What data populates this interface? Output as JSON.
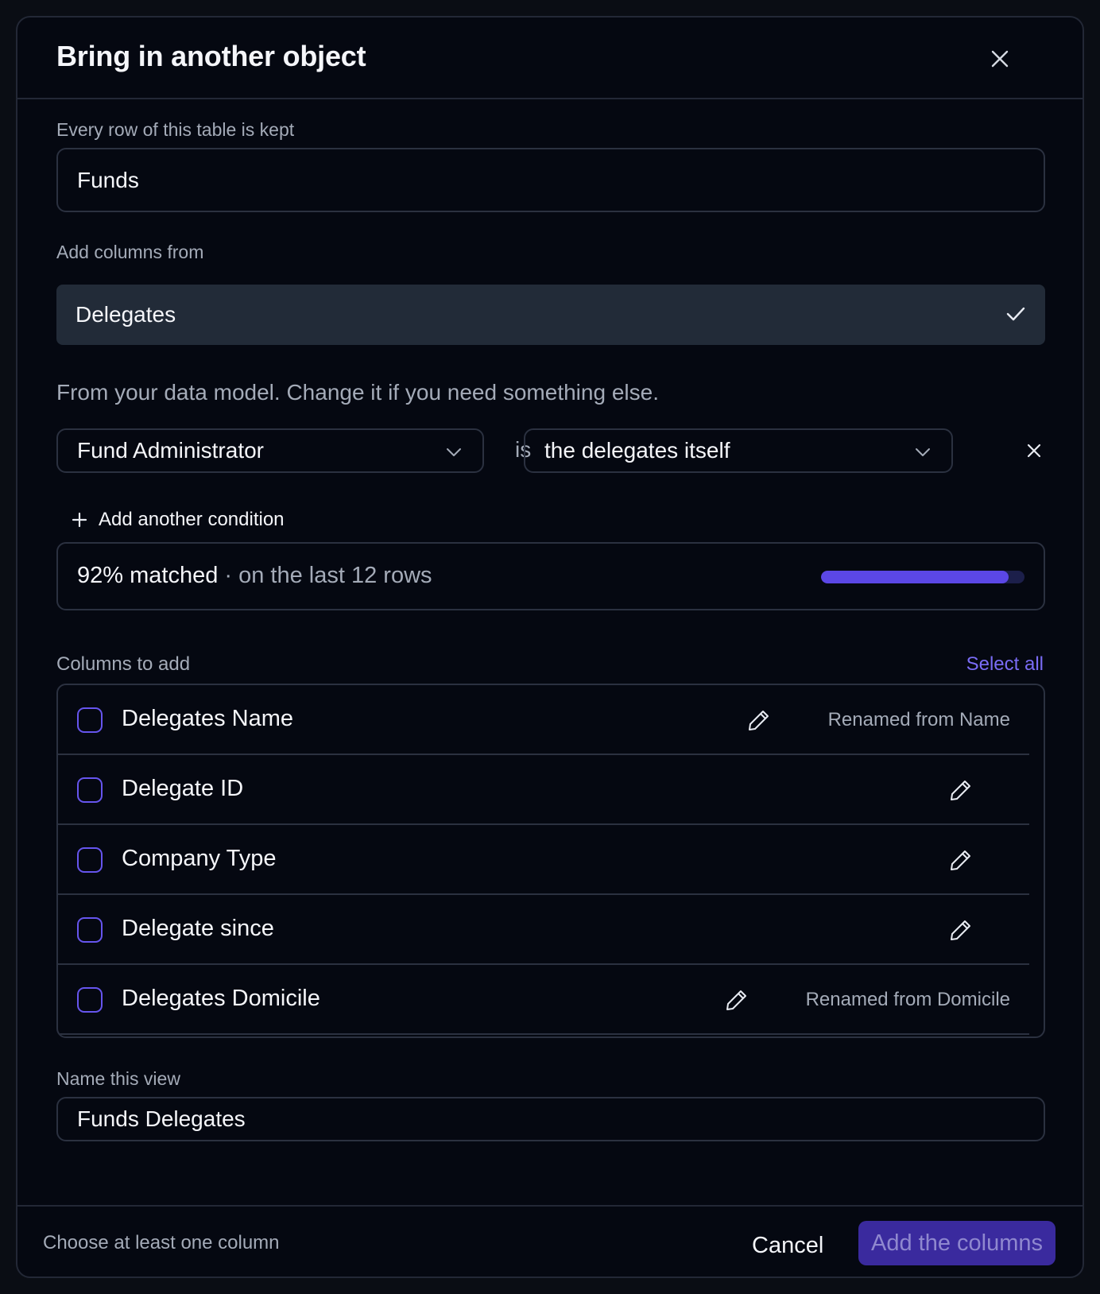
{
  "dialog": {
    "title": "Bring in another object"
  },
  "base_table": {
    "label": "Every row of this table is kept",
    "value": "Funds"
  },
  "source": {
    "label": "Add columns from",
    "selected": "Delegates",
    "hint": "From your data model. Change it if you need something else."
  },
  "condition": {
    "left_field": "Fund Administrator",
    "operator": "is",
    "right_value": "the delegates itself",
    "add_label": "Add another condition"
  },
  "match": {
    "percent_label": "92% matched",
    "detail": "· on the last 12 rows",
    "fraction": 0.92
  },
  "columns": {
    "label": "Columns to add",
    "select_all": "Select all",
    "items": [
      {
        "name": "Delegates Name",
        "renamed": "Renamed from Name",
        "checked": false
      },
      {
        "name": "Delegate ID",
        "renamed": "",
        "checked": false
      },
      {
        "name": "Company Type",
        "renamed": "",
        "checked": false
      },
      {
        "name": "Delegate since",
        "renamed": "",
        "checked": false
      },
      {
        "name": "Delegates Domicile",
        "renamed": "Renamed from Domicile",
        "checked": false
      }
    ]
  },
  "view_name": {
    "label": "Name this view",
    "value": "Funds Delegates"
  },
  "footer": {
    "hint": "Choose at least one column",
    "cancel": "Cancel",
    "submit": "Add the columns"
  },
  "icons": {
    "close": "close-icon",
    "check": "check-icon",
    "chevron": "chevron-down-icon",
    "plus": "plus-icon",
    "edit": "pencil-icon"
  },
  "colors": {
    "accent": "#5b47e6",
    "link": "#7a6cf5",
    "primary_button": "#3a2a9e"
  }
}
